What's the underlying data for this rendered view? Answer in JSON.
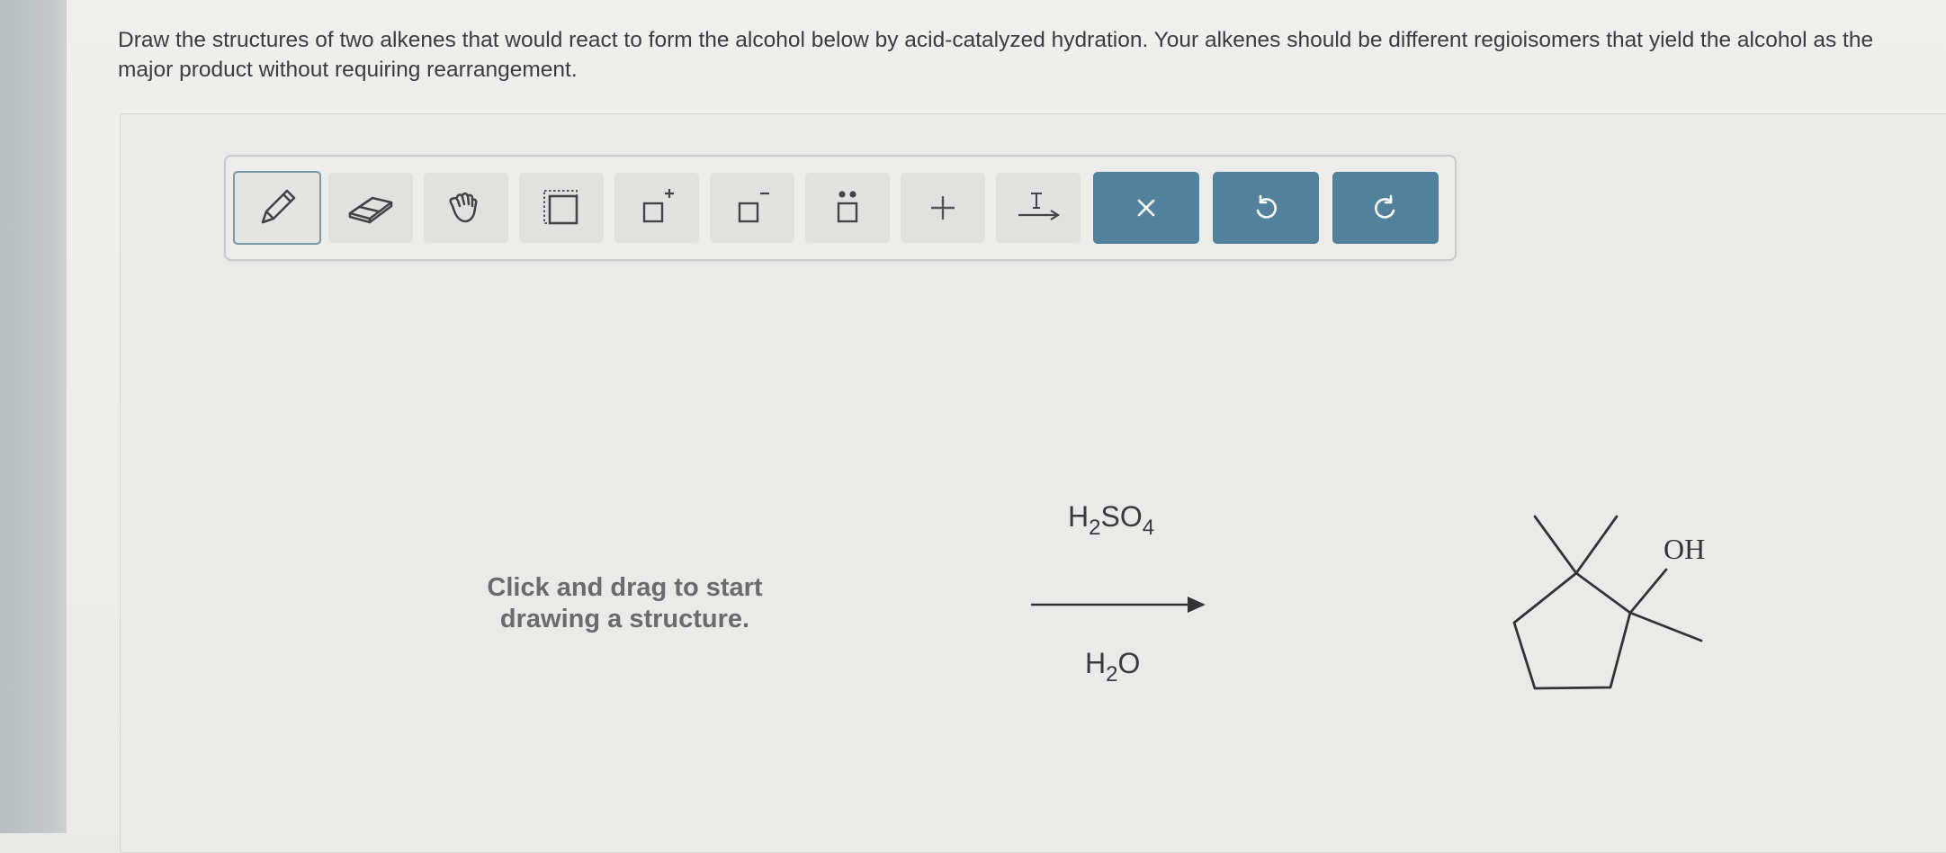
{
  "question": {
    "text": "Draw the structures of two alkenes that would react to form the alcohol below by acid-catalyzed hydration. Your alkenes should be different regioisomers that yield the alcohol as the major product without requiring rearrangement."
  },
  "toolbar": {
    "tools": [
      {
        "name": "pencil-icon",
        "active": true
      },
      {
        "name": "eraser-icon"
      },
      {
        "name": "hand-icon"
      },
      {
        "name": "marquee-select-icon"
      },
      {
        "name": "positive-charge-icon"
      },
      {
        "name": "negative-charge-icon"
      },
      {
        "name": "lone-pair-icon"
      },
      {
        "name": "plus-icon"
      },
      {
        "name": "text-arrow-icon"
      },
      {
        "name": "close-icon"
      },
      {
        "name": "undo-icon"
      },
      {
        "name": "redo-icon"
      }
    ],
    "accent_color": "#52819b"
  },
  "canvas": {
    "placeholder_line1": "Click and drag to start",
    "placeholder_line2": "drawing a structure."
  },
  "reaction": {
    "top_reagent": {
      "a": "H",
      "b": "2",
      "c": "SO",
      "d": "4"
    },
    "bottom_reagent": {
      "a": "H",
      "b": "2",
      "c": "O"
    },
    "product_label": "OH"
  }
}
